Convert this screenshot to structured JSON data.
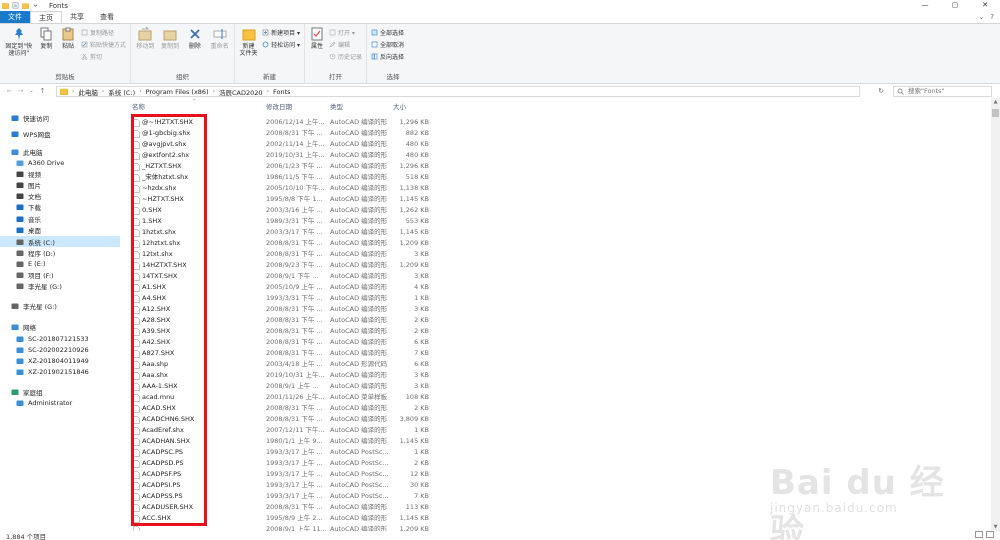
{
  "window": {
    "title": "Fonts",
    "controls": [
      "—",
      "▢",
      "✕"
    ]
  },
  "tabs": [
    {
      "label": "文件"
    },
    {
      "label": "主页"
    },
    {
      "label": "共享"
    },
    {
      "label": "查看"
    }
  ],
  "ribbon": {
    "clipboard": {
      "label": "剪贴板",
      "pin": "固定到\"快速访问\"",
      "copy": "复制",
      "paste": "粘贴",
      "copy_path": "复制路径",
      "paste_shortcut": "粘贴快捷方式",
      "cut": "剪切"
    },
    "organize": {
      "label": "组织",
      "move_to": "移动到",
      "copy_to": "复制到",
      "delete": "删除",
      "rename": "重命名"
    },
    "new": {
      "label": "新建",
      "new_folder": "新建\n文件夹",
      "new_item": "新建项目 ▾",
      "easy_access": "轻松访问 ▾"
    },
    "open": {
      "label": "打开",
      "properties": "属性",
      "open": "打开 ▾",
      "edit": "编辑",
      "history": "历史记录"
    },
    "select": {
      "label": "选择",
      "select_all": "全部选择",
      "select_none": "全部取消",
      "invert": "反向选择"
    }
  },
  "address": {
    "crumbs": [
      "此电脑",
      "系统 (C:)",
      "Program Files (x86)",
      "浩辰CAD2020",
      "Fonts"
    ],
    "search_placeholder": "搜索\"Fonts\""
  },
  "nav": {
    "items": [
      {
        "label": "快速访问",
        "icon": "star-icon",
        "color": "#2b7cd3"
      },
      {
        "label": "WPS网盘",
        "icon": "cloud-icon",
        "color": "#2b7cd3"
      },
      {
        "label": "此电脑",
        "icon": "computer-icon",
        "color": "#3a8fd6"
      },
      {
        "label": "A360 Drive",
        "icon": "drive-icon",
        "color": "#5aa0d8"
      },
      {
        "label": "视频",
        "icon": "video-icon",
        "color": "#444"
      },
      {
        "label": "图片",
        "icon": "picture-icon",
        "color": "#444"
      },
      {
        "label": "文档",
        "icon": "document-icon",
        "color": "#444"
      },
      {
        "label": "下载",
        "icon": "download-icon",
        "color": "#1a6fc6"
      },
      {
        "label": "音乐",
        "icon": "music-icon",
        "color": "#1a6fc6"
      },
      {
        "label": "桌面",
        "icon": "desktop-icon",
        "color": "#1a6fc6"
      },
      {
        "label": "系统 (C:)",
        "icon": "disk-icon",
        "color": "#666"
      },
      {
        "label": "程序 (D:)",
        "icon": "disk-icon",
        "color": "#666"
      },
      {
        "label": "E (E:)",
        "icon": "disk-icon",
        "color": "#666"
      },
      {
        "label": "项目 (F:)",
        "icon": "disk-icon",
        "color": "#666"
      },
      {
        "label": "李光星 (G:)",
        "icon": "disk-icon",
        "color": "#666"
      },
      {
        "label": "李光星 (G:)",
        "icon": "disk-icon",
        "color": "#666"
      },
      {
        "label": "网络",
        "icon": "network-icon",
        "color": "#3a8fd6"
      },
      {
        "label": "SC-201807121533",
        "icon": "monitor-icon",
        "color": "#3a8fd6"
      },
      {
        "label": "SC-202002210926",
        "icon": "monitor-icon",
        "color": "#3a8fd6"
      },
      {
        "label": "XZ-201804011949",
        "icon": "monitor-icon",
        "color": "#3a8fd6"
      },
      {
        "label": "XZ-201902151846",
        "icon": "monitor-icon",
        "color": "#3a8fd6"
      },
      {
        "label": "家庭组",
        "icon": "homegroup-icon",
        "color": "#2a9d6d"
      },
      {
        "label": "Administrator",
        "icon": "user-icon",
        "color": "#3a8fd6"
      }
    ]
  },
  "columns": {
    "name": "名称",
    "date": "修改日期",
    "type": "类型",
    "size": "大小"
  },
  "files": [
    {
      "name": "@~!HZTXT.SHX",
      "date": "2006/12/14 上午...",
      "type": "AutoCAD 编译的形",
      "size": "1,296 KB"
    },
    {
      "name": "@1-gbcbig.shx",
      "date": "2008/8/31 下午 ...",
      "type": "AutoCAD 编译的形",
      "size": "882 KB"
    },
    {
      "name": "@avgjpvt.shx",
      "date": "2002/11/14 上午...",
      "type": "AutoCAD 编译的形",
      "size": "480 KB"
    },
    {
      "name": "@extfont2.shx",
      "date": "2019/10/31 上午...",
      "type": "AutoCAD 编译的形",
      "size": "480 KB"
    },
    {
      "name": "_HZTXT.SHX",
      "date": "2006/1/23 下午 ...",
      "type": "AutoCAD 编译的形",
      "size": "1,296 KB"
    },
    {
      "name": "_宋体hztxt.shx",
      "date": "1986/11/5 下午 ...",
      "type": "AutoCAD 编译的形",
      "size": "518 KB"
    },
    {
      "name": "~hzdx.shx",
      "date": "2005/10/10 下午...",
      "type": "AutoCAD 编译的形",
      "size": "1,138 KB"
    },
    {
      "name": "~HZTXT.SHX",
      "date": "1995/8/8 下午 1...",
      "type": "AutoCAD 编译的形",
      "size": "1,145 KB"
    },
    {
      "name": "0.SHX",
      "date": "2003/3/16 上午 ...",
      "type": "AutoCAD 编译的形",
      "size": "1,262 KB"
    },
    {
      "name": "1.SHX",
      "date": "1989/3/31 下午 ...",
      "type": "AutoCAD 编译的形",
      "size": "553 KB"
    },
    {
      "name": "1hztxt.shx",
      "date": "2003/3/17 下午 ...",
      "type": "AutoCAD 编译的形",
      "size": "1,145 KB"
    },
    {
      "name": "12hztxt.shx",
      "date": "2008/8/31 下午 ...",
      "type": "AutoCAD 编译的形",
      "size": "1,209 KB"
    },
    {
      "name": "12txt.shx",
      "date": "2008/8/31 下午 ...",
      "type": "AutoCAD 编译的形",
      "size": "3 KB"
    },
    {
      "name": "14HZTXT.SHX",
      "date": "2008/9/23 下午 ...",
      "type": "AutoCAD 编译的形",
      "size": "1,209 KB"
    },
    {
      "name": "14TXT.SHX",
      "date": "2008/9/1 下午 ...",
      "type": "AutoCAD 编译的形",
      "size": "3 KB"
    },
    {
      "name": "A1.SHX",
      "date": "2005/10/9 上午 ...",
      "type": "AutoCAD 编译的形",
      "size": "4 KB"
    },
    {
      "name": "A4.SHX",
      "date": "1993/3/31 下午 ...",
      "type": "AutoCAD 编译的形",
      "size": "1 KB"
    },
    {
      "name": "A12.SHX",
      "date": "2008/8/31 下午 ...",
      "type": "AutoCAD 编译的形",
      "size": "3 KB"
    },
    {
      "name": "A28.SHX",
      "date": "2008/8/31 下午 ...",
      "type": "AutoCAD 编译的形",
      "size": "2 KB"
    },
    {
      "name": "A39.SHX",
      "date": "2008/8/31 下午 ...",
      "type": "AutoCAD 编译的形",
      "size": "2 KB"
    },
    {
      "name": "A42.SHX",
      "date": "2008/8/31 下午 ...",
      "type": "AutoCAD 编译的形",
      "size": "6 KB"
    },
    {
      "name": "A827.SHX",
      "date": "2008/8/31 下午 ...",
      "type": "AutoCAD 编译的形",
      "size": "7 KB"
    },
    {
      "name": "Aaa.shp",
      "date": "2003/4/18 上午 ...",
      "type": "AutoCAD 形源代码",
      "size": "6 KB"
    },
    {
      "name": "Aaa.shx",
      "date": "2019/10/31 上午...",
      "type": "AutoCAD 编译的形",
      "size": "3 KB"
    },
    {
      "name": "AAA-1.SHX",
      "date": "2008/9/1 上午 ...",
      "type": "AutoCAD 编译的形",
      "size": "3 KB"
    },
    {
      "name": "acad.mnu",
      "date": "2001/11/26 上午...",
      "type": "AutoCAD 菜单样板",
      "size": "108 KB"
    },
    {
      "name": "ACAD.SHX",
      "date": "2008/8/31 下午 ...",
      "type": "AutoCAD 编译的形",
      "size": "2 KB"
    },
    {
      "name": "ACADCHN6.SHX",
      "date": "2008/8/31 下午 ...",
      "type": "AutoCAD 编译的形",
      "size": "3,809 KB"
    },
    {
      "name": "AcadEref.shx",
      "date": "2007/12/11 下午...",
      "type": "AutoCAD 编译的形",
      "size": "1 KB"
    },
    {
      "name": "ACADHAN.SHX",
      "date": "1980/1/1 上午 9...",
      "type": "AutoCAD 编译的形",
      "size": "1,145 KB"
    },
    {
      "name": "ACADPSC.PS",
      "date": "1993/3/17 上午 ...",
      "type": "AutoCAD PostSc...",
      "size": "1 KB"
    },
    {
      "name": "ACADPSD.PS",
      "date": "1993/3/17 上午 ...",
      "type": "AutoCAD PostSc...",
      "size": "2 KB"
    },
    {
      "name": "ACADPSF.PS",
      "date": "1993/3/17 上午 ...",
      "type": "AutoCAD PostSc...",
      "size": "12 KB"
    },
    {
      "name": "ACADPSI.PS",
      "date": "1993/3/17 上午 ...",
      "type": "AutoCAD PostSc...",
      "size": "30 KB"
    },
    {
      "name": "ACADPSS.PS",
      "date": "1993/3/17 上午 ...",
      "type": "AutoCAD PostSc...",
      "size": "7 KB"
    },
    {
      "name": "ACADUSER.SHX",
      "date": "2008/8/31 下午 ...",
      "type": "AutoCAD 编译的形",
      "size": "113 KB"
    },
    {
      "name": "ACC.SHX",
      "date": "1995/8/9 上午 2...",
      "type": "AutoCAD 编译的形",
      "size": "1,145 KB"
    },
    {
      "name": "",
      "date": "2008/9/1 上午 11...",
      "type": "AutoCAD 编译的形",
      "size": "1,209 KB"
    }
  ],
  "status": {
    "count": "1,884 个项目"
  },
  "watermark": {
    "brand": "Bai du 经验",
    "url": "jingyan.baidu.com"
  },
  "colors": {
    "accent": "#1979ca",
    "highlight_box": "#e8101b",
    "selected_nav": "#cce8ff"
  }
}
